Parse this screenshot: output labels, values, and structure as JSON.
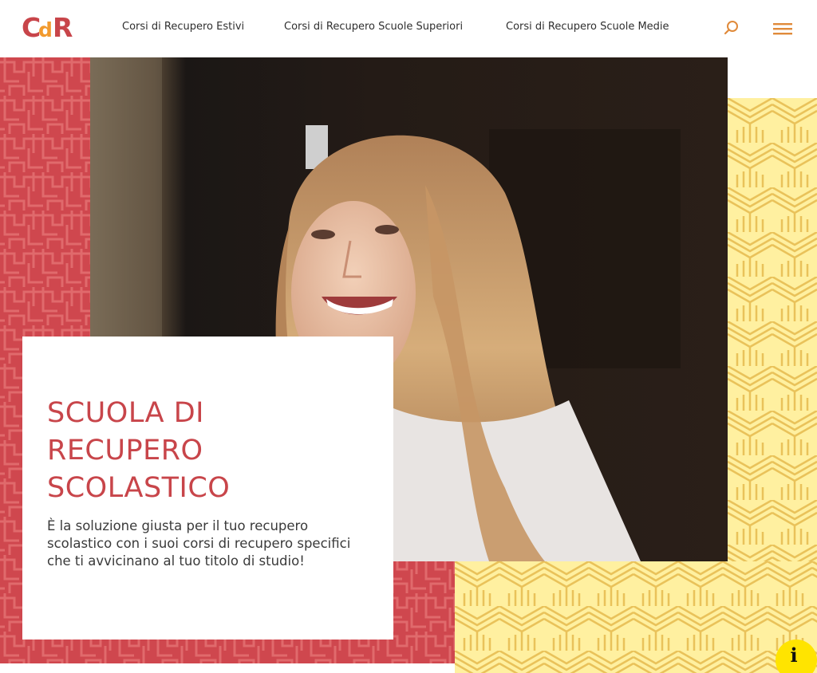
{
  "brand": {
    "logo_text": "CdR",
    "colors": {
      "red": "#c8454a",
      "orange": "#f29a2e",
      "yellow": "#ffe98a",
      "yellow_line": "#e7b84c"
    }
  },
  "nav": {
    "items": [
      {
        "label": "Corsi di Recupero Estivi"
      },
      {
        "label": "Corsi di Recupero Scuole Superiori"
      },
      {
        "label": "Corsi di Recupero Scuole Medie"
      }
    ],
    "search_icon": "search-icon",
    "menu_icon": "hamburger-menu-icon"
  },
  "hero": {
    "title": "SCUOLA DI RECUPERO SCOLASTICO",
    "description": "È la soluzione giusta per il tuo recupero scolastico con i suoi corsi di recupero specifici che ti avvicinano al tuo titolo di studio!"
  },
  "info_button": {
    "icon": "info-icon",
    "label": "i"
  }
}
